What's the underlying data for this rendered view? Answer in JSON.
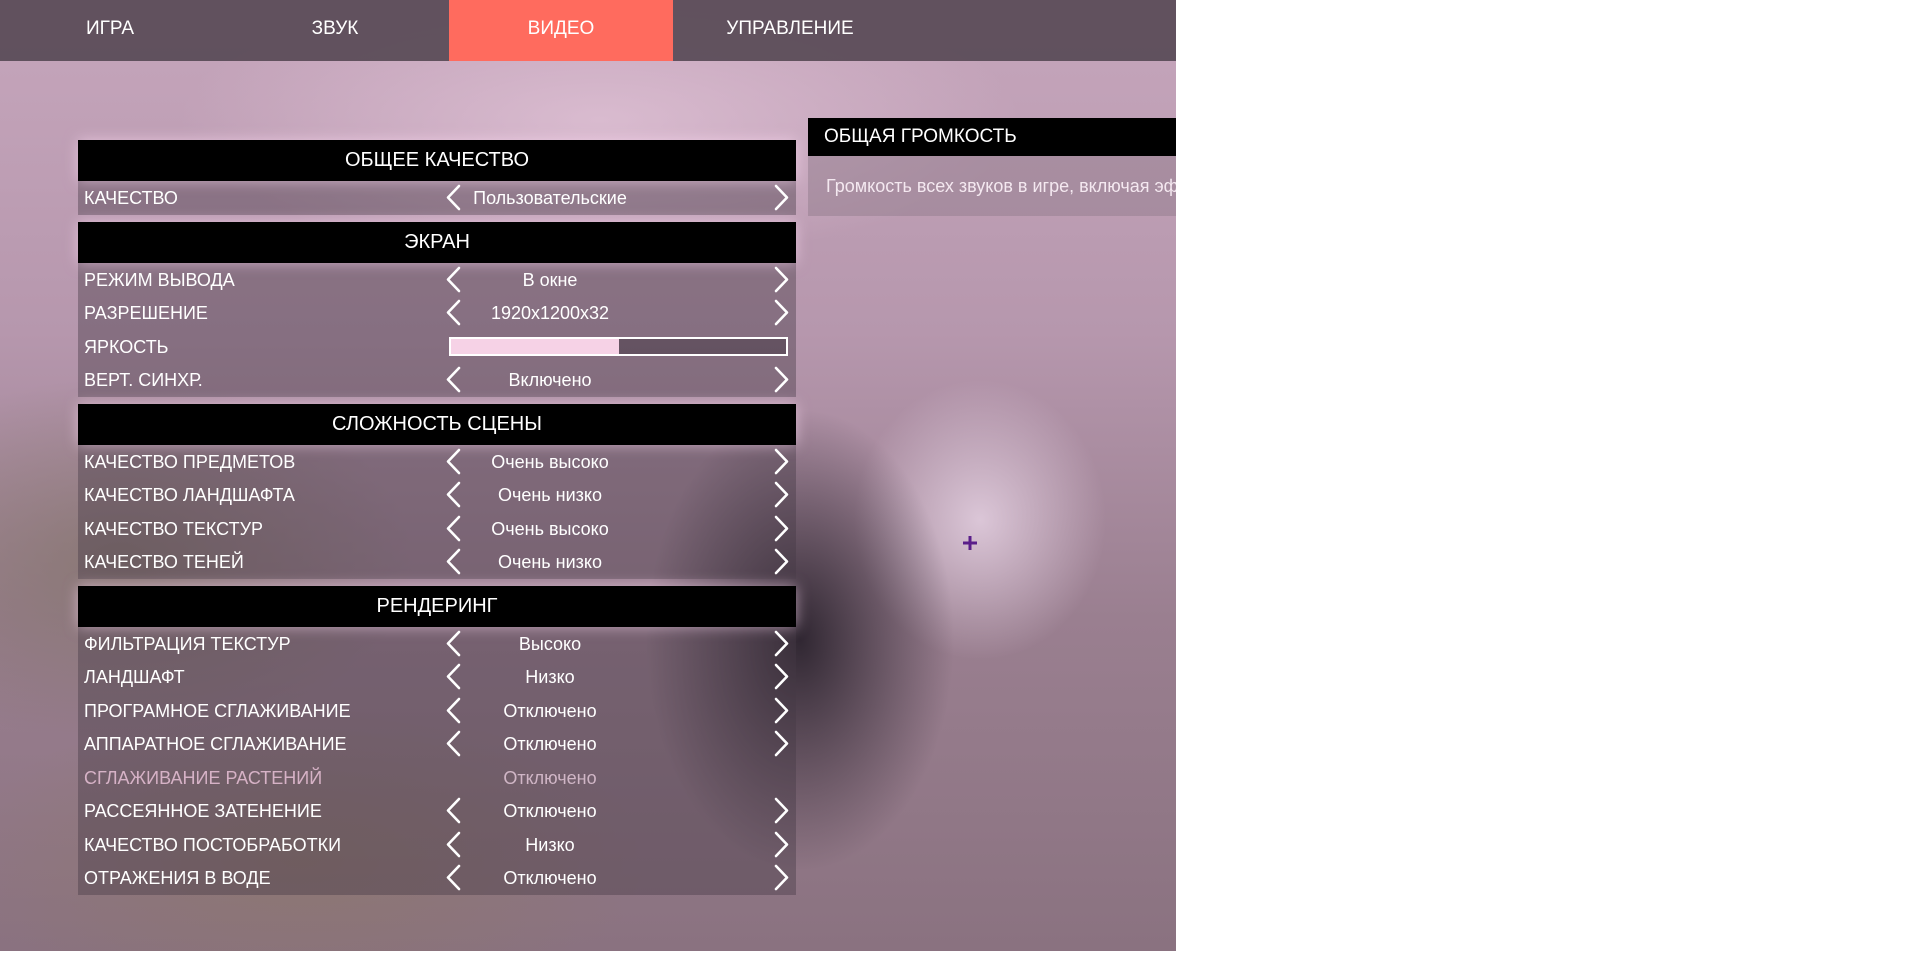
{
  "tabs": [
    {
      "label": "ИГРА",
      "active": false
    },
    {
      "label": "ЗВУК",
      "active": false
    },
    {
      "label": "ВИДЕО",
      "active": true
    },
    {
      "label": "УПРАВЛЕНИЕ",
      "active": false
    }
  ],
  "watermark": "...",
  "colors": {
    "active_tab": "#ff6b5e",
    "header_bg": "#000000",
    "slider_fill": "#f6d2e6"
  },
  "sections": [
    {
      "title": "ОБЩЕЕ КАЧЕСТВО",
      "rows": [
        {
          "label": "КАЧЕСТВО",
          "value": "Пользовательские"
        }
      ]
    },
    {
      "title": "ЭКРАН",
      "rows": [
        {
          "label": "РЕЖИМ ВЫВОДА",
          "value": "В окне"
        },
        {
          "label": "РАЗРЕШЕНИЕ",
          "value": "1920x1200x32"
        },
        {
          "label": "ЯРКОСТЬ",
          "slider_fraction": 0.5
        },
        {
          "label": "ВЕРТ. СИНХР.",
          "value": "Включено"
        }
      ]
    },
    {
      "title": "СЛОЖНОСТЬ СЦЕНЫ",
      "rows": [
        {
          "label": "КАЧЕСТВО ПРЕДМЕТОВ",
          "value": "Очень высоко"
        },
        {
          "label": "КАЧЕСТВО ЛАНДШАФТА",
          "value": "Очень низко"
        },
        {
          "label": "КАЧЕСТВО ТЕКСТУР",
          "value": "Очень высоко"
        },
        {
          "label": "КАЧЕСТВО ТЕНЕЙ",
          "value": "Очень низко"
        }
      ]
    },
    {
      "title": "РЕНДЕРИНГ",
      "rows": [
        {
          "label": "ФИЛЬТРАЦИЯ ТЕКСТУР",
          "value": "Высоко"
        },
        {
          "label": "ЛАНДШАФТ",
          "value": "Низко"
        },
        {
          "label": "ПРОГРАМНОЕ СГЛАЖИВАНИЕ",
          "value": "Отключено"
        },
        {
          "label": "АППАРАТНОЕ СГЛАЖИВАНИЕ",
          "value": "Отключено"
        },
        {
          "label": "СГЛАЖИВАНИЕ РАСТЕНИЙ",
          "value": "Отключено",
          "disabled": true
        },
        {
          "label": "РАССЕЯННОЕ ЗАТЕНЕНИЕ",
          "value": "Отключено"
        },
        {
          "label": "КАЧЕСТВО ПОСТОБРАБОТКИ",
          "value": "Низко"
        },
        {
          "label": "ОТРАЖЕНИЯ В ВОДЕ",
          "value": "Отключено"
        }
      ]
    }
  ],
  "info": {
    "title": "ОБЩАЯ ГРОМКОСТЬ",
    "text": "Громкость всех звуков в игре, включая эф"
  },
  "icons": {
    "left_arrow": "chevron-left-icon",
    "right_arrow": "chevron-right-icon",
    "cursor": "crosshair-icon"
  }
}
